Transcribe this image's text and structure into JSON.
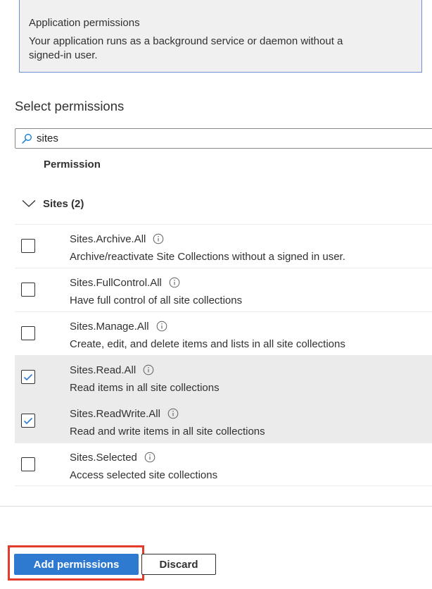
{
  "info_card": {
    "title": "Application permissions",
    "description": "Your application runs as a background service or daemon without a signed-in user."
  },
  "select_permissions": {
    "title": "Select permissions",
    "search_value": "sites"
  },
  "table": {
    "column_header": "Permission",
    "group_label": "Sites (2)",
    "group_expanded": true,
    "rows": [
      {
        "name": "Sites.Archive.All",
        "description": "Archive/reactivate Site Collections without a signed in user.",
        "checked": false
      },
      {
        "name": "Sites.FullControl.All",
        "description": "Have full control of all site collections",
        "checked": false
      },
      {
        "name": "Sites.Manage.All",
        "description": "Create, edit, and delete items and lists in all site collections",
        "checked": false
      },
      {
        "name": "Sites.Read.All",
        "description": "Read items in all site collections",
        "checked": true
      },
      {
        "name": "Sites.ReadWrite.All",
        "description": "Read and write items in all site collections",
        "checked": true
      },
      {
        "name": "Sites.Selected",
        "description": "Access selected site collections",
        "checked": false
      }
    ]
  },
  "footer": {
    "add_label": "Add permissions",
    "discard_label": "Discard"
  },
  "icons": {
    "search": "search-icon",
    "chevron": "chevron-down-icon",
    "info": "info-icon",
    "check": "checkmark-icon"
  },
  "colors": {
    "primary": "#2f7ad1",
    "checkmark": "#2f7ad1",
    "info_border": "#6e8fd6",
    "info_bg": "#f0f0f0",
    "selected_row_bg": "#ebebeb",
    "highlight_outline": "#e33a2a"
  }
}
